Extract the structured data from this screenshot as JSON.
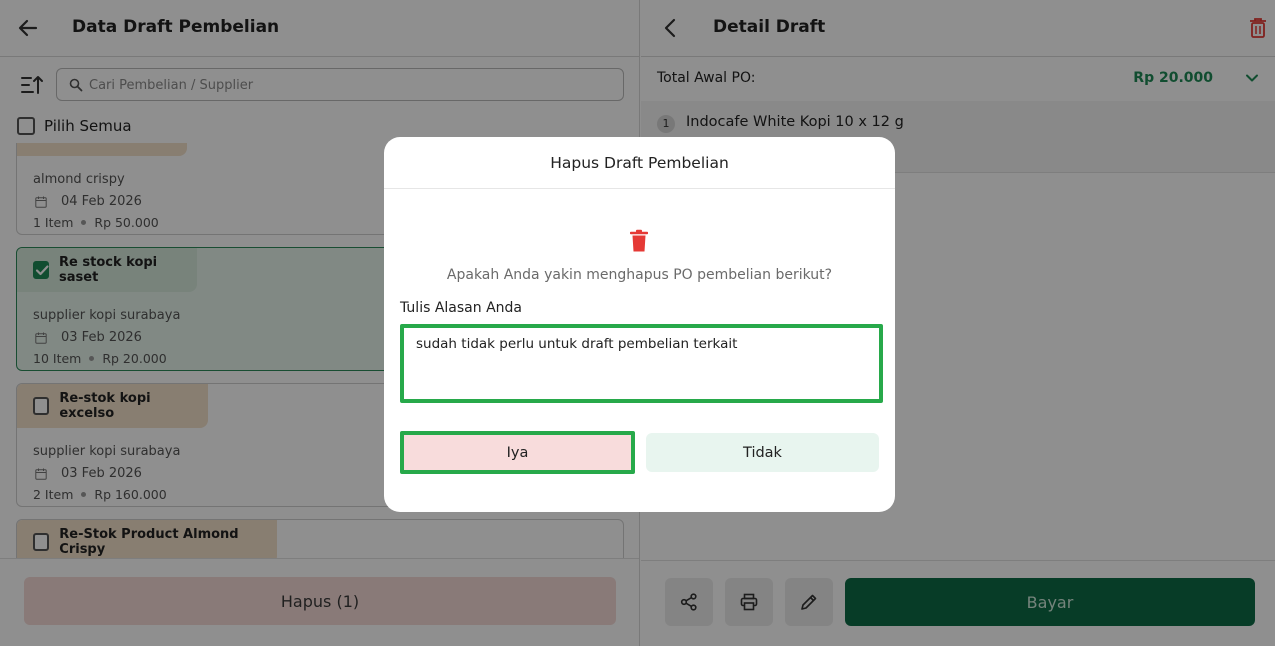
{
  "left_panel": {
    "title": "Data Draft Pembelian",
    "search_placeholder": "Cari Pembelian / Supplier",
    "select_all_label": "Pilih Semua",
    "cards": [
      {
        "name": "",
        "supplier": "almond crispy",
        "date": "04 Feb 2026",
        "items": "1 Item",
        "total": "Rp 50.000",
        "checked": false
      },
      {
        "name": "Re stock kopi saset",
        "supplier": "supplier kopi surabaya",
        "date": "03 Feb 2026",
        "items": "10 Item",
        "total": "Rp 20.000",
        "checked": true
      },
      {
        "name": "Re-stok kopi excelso",
        "supplier": "supplier kopi surabaya",
        "date": "03 Feb 2026",
        "items": "2 Item",
        "total": "Rp 160.000",
        "checked": false
      },
      {
        "name": "Re-Stok Product Almond Crispy",
        "supplier": "",
        "date": "",
        "items": "",
        "total": "",
        "checked": false
      }
    ],
    "delete_button": "Hapus (1)"
  },
  "right_panel": {
    "title": "Detail Draft",
    "total_label": "Total Awal PO:",
    "total_value": "Rp 20.000",
    "items": [
      {
        "number": "1",
        "name": "Indocafe White Kopi 10 x 12 g"
      }
    ],
    "pay_button": "Bayar",
    "action_icons": [
      "share-icon",
      "print-icon",
      "edit-icon"
    ]
  },
  "modal": {
    "title": "Hapus Draft Pembelian",
    "question": "Apakah Anda yakin menghapus PO pembelian berikut?",
    "reason_label": "Tulis Alasan Anda",
    "reason_value": "sudah tidak perlu untuk draft pembelian terkait",
    "confirm_label": "Iya",
    "cancel_label": "Tidak"
  },
  "colors": {
    "primary_green": "#0e6b47",
    "accent_green": "#1f8a56",
    "danger_red": "#e53935",
    "highlight_green": "#27a94a"
  }
}
